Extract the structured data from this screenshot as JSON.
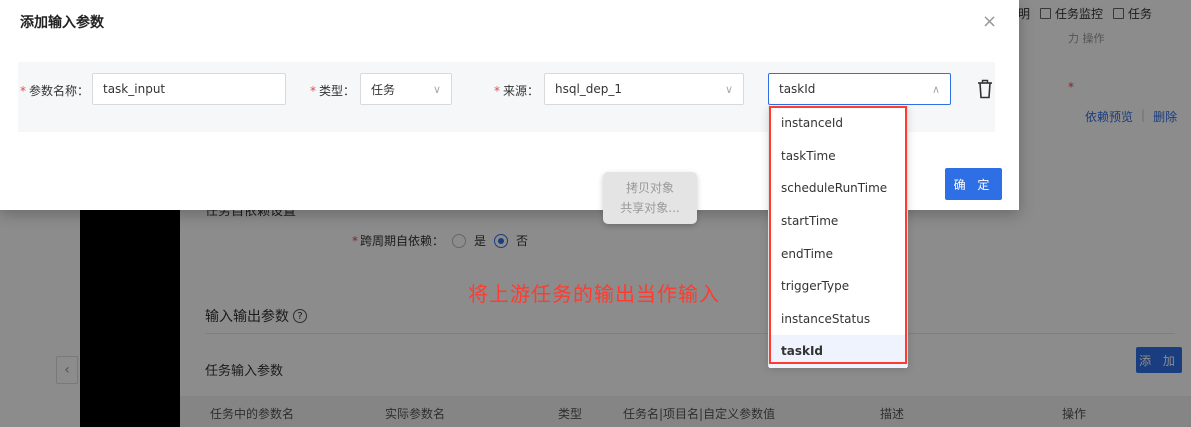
{
  "modal": {
    "title": "添加输入参数",
    "close_symbol": "×",
    "confirm_label": "确 定",
    "fields": {
      "param_name": {
        "label": "参数名称：",
        "value": "task_input"
      },
      "type": {
        "label": "类型：",
        "value": "任务"
      },
      "source": {
        "label": "来源：",
        "value": "hsql_dep_1"
      },
      "field": {
        "value": "taskId"
      }
    },
    "required_mark": "*"
  },
  "dropdown": {
    "options": [
      "instanceId",
      "taskTime",
      "scheduleRunTime",
      "startTime",
      "endTime",
      "triggerType",
      "instanceStatus",
      "taskId"
    ],
    "selected": "taskId"
  },
  "context_menu": {
    "items": [
      "拷贝对象",
      "共享对象..."
    ]
  },
  "background": {
    "topbar": {
      "item1": "明",
      "item2": "任务监控",
      "item3": "任务"
    },
    "subhead": "力 操作",
    "ops": {
      "preview": "依赖预览",
      "delete": "删除",
      "sep": "|"
    },
    "section_cut": "任务自依赖设置",
    "cross_cycle": {
      "label": "跨周期自依赖：",
      "yes": "是",
      "no": "否"
    },
    "io_title": "输入输出参数",
    "input_title": "任务输入参数",
    "add_label": "添 加",
    "collapse_symbol": "‹",
    "table_headers": [
      "任务中的参数名",
      "实际参数名",
      "类型",
      "任务名|项目名|自定义参数值",
      "描述",
      "操作"
    ]
  },
  "annotation": "将上游任务的输出当作输入"
}
